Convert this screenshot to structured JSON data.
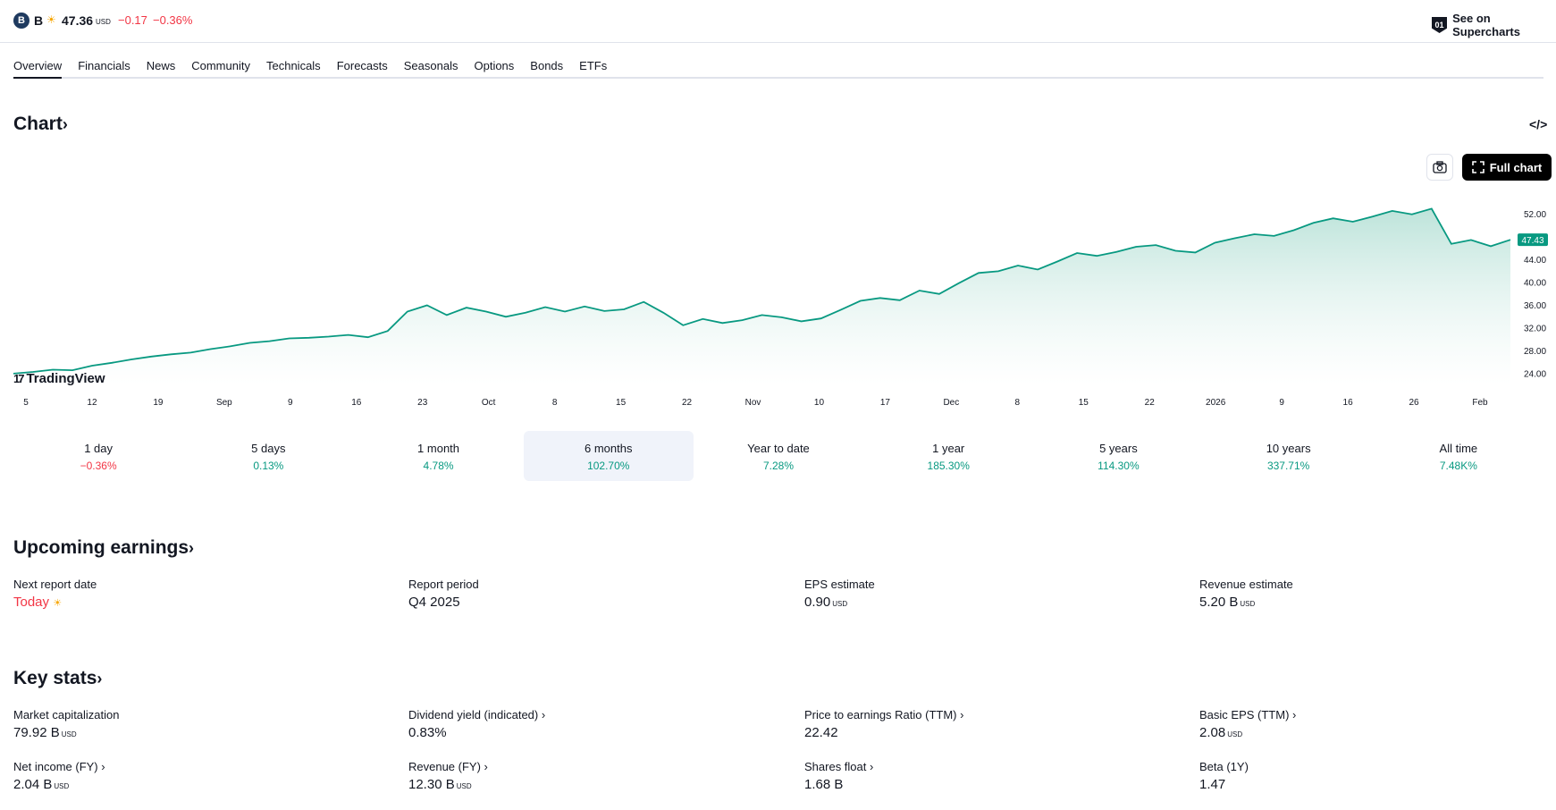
{
  "header": {
    "logo_letter": "B",
    "symbol": "B",
    "sun_icon": "sun-icon",
    "price": "47.36",
    "price_unit": "USD",
    "change": "−0.17",
    "change_pct": "−0.36%",
    "supercharts_icon_text": "01",
    "supercharts_label": "See on Supercharts"
  },
  "tabs": [
    "Overview",
    "Financials",
    "News",
    "Community",
    "Technicals",
    "Forecasts",
    "Seasonals",
    "Options",
    "Bonds",
    "ETFs"
  ],
  "chart_section": {
    "title": "Chart",
    "chevron": "›",
    "embed_icon_text": "</>",
    "full_chart_label": "Full chart",
    "brand": "TradingView",
    "brand_mark": "17"
  },
  "chart_data": {
    "type": "area",
    "current_value_label": "47.43",
    "ylim": [
      22,
      55
    ],
    "y_ticks": [
      "52.00",
      "48.00",
      "44.00",
      "40.00",
      "36.00",
      "32.00",
      "28.00",
      "24.00"
    ],
    "x_ticks": [
      "5",
      "12",
      "19",
      "Sep",
      "9",
      "16",
      "23",
      "Oct",
      "8",
      "15",
      "22",
      "Nov",
      "10",
      "17",
      "Dec",
      "8",
      "15",
      "22",
      "2026",
      "9",
      "16",
      "26",
      "Feb"
    ],
    "series": [
      {
        "values": [
          23.9,
          24.2,
          24.6,
          24.5,
          25.3,
          25.8,
          26.4,
          26.9,
          27.3,
          27.6,
          28.2,
          28.7,
          29.3,
          29.6,
          30.1,
          30.2,
          30.4,
          30.7,
          30.3,
          31.4,
          34.8,
          35.9,
          34.2,
          35.5,
          34.8,
          33.9,
          34.6,
          35.6,
          34.8,
          35.7,
          34.9,
          35.2,
          36.5,
          34.6,
          32.4,
          33.5,
          32.8,
          33.3,
          34.2,
          33.8,
          33.1,
          33.6,
          35.1,
          36.7,
          37.2,
          36.8,
          38.5,
          37.9,
          39.8,
          41.6,
          41.9,
          42.9,
          42.2,
          43.6,
          45.1,
          44.6,
          45.3,
          46.2,
          46.5,
          45.5,
          45.2,
          46.9,
          47.7,
          48.4,
          48.1,
          49.1,
          50.4,
          51.2,
          50.6,
          51.5,
          52.5,
          51.9,
          52.9,
          46.7,
          47.4,
          46.3,
          47.43
        ]
      }
    ]
  },
  "periods": [
    {
      "label": "1 day",
      "value": "−0.36%",
      "dir": "down"
    },
    {
      "label": "5 days",
      "value": "0.13%",
      "dir": "up"
    },
    {
      "label": "1 month",
      "value": "4.78%",
      "dir": "up"
    },
    {
      "label": "6 months",
      "value": "102.70%",
      "dir": "up"
    },
    {
      "label": "Year to date",
      "value": "7.28%",
      "dir": "up"
    },
    {
      "label": "1 year",
      "value": "185.30%",
      "dir": "up"
    },
    {
      "label": "5 years",
      "value": "114.30%",
      "dir": "up"
    },
    {
      "label": "10 years",
      "value": "337.71%",
      "dir": "up"
    },
    {
      "label": "All time",
      "value": "7.48K%",
      "dir": "up"
    }
  ],
  "earnings": {
    "title": "Upcoming earnings",
    "next_report_label": "Next report date",
    "next_report_value": "Today",
    "report_period_label": "Report period",
    "report_period_value": "Q4 2025",
    "eps_label": "EPS estimate",
    "eps_value": "0.90",
    "eps_unit": "USD",
    "revenue_label": "Revenue estimate",
    "revenue_value": "5.20 B",
    "revenue_unit": "USD"
  },
  "key_stats": {
    "title": "Key stats",
    "market_cap_label": "Market capitalization",
    "market_cap_value": "79.92 B",
    "market_cap_unit": "USD",
    "dividend_label": "Dividend yield (indicated)",
    "dividend_value": "0.83%",
    "pe_label": "Price to earnings Ratio (TTM)",
    "pe_value": "22.42",
    "eps_label": "Basic EPS (TTM)",
    "eps_value": "2.08",
    "eps_unit": "USD",
    "net_income_label": "Net income (FY)",
    "net_income_value": "2.04 B",
    "net_income_unit": "USD",
    "revenue_label": "Revenue (FY)",
    "revenue_value": "12.30 B",
    "revenue_unit": "USD",
    "float_label": "Shares float",
    "float_value": "1.68 B",
    "beta_label": "Beta (1Y)",
    "beta_value": "1.47"
  },
  "colors": {
    "line": "#089981",
    "area_top": "#b9e2d8",
    "down": "#f23645",
    "today": "#f23645"
  }
}
